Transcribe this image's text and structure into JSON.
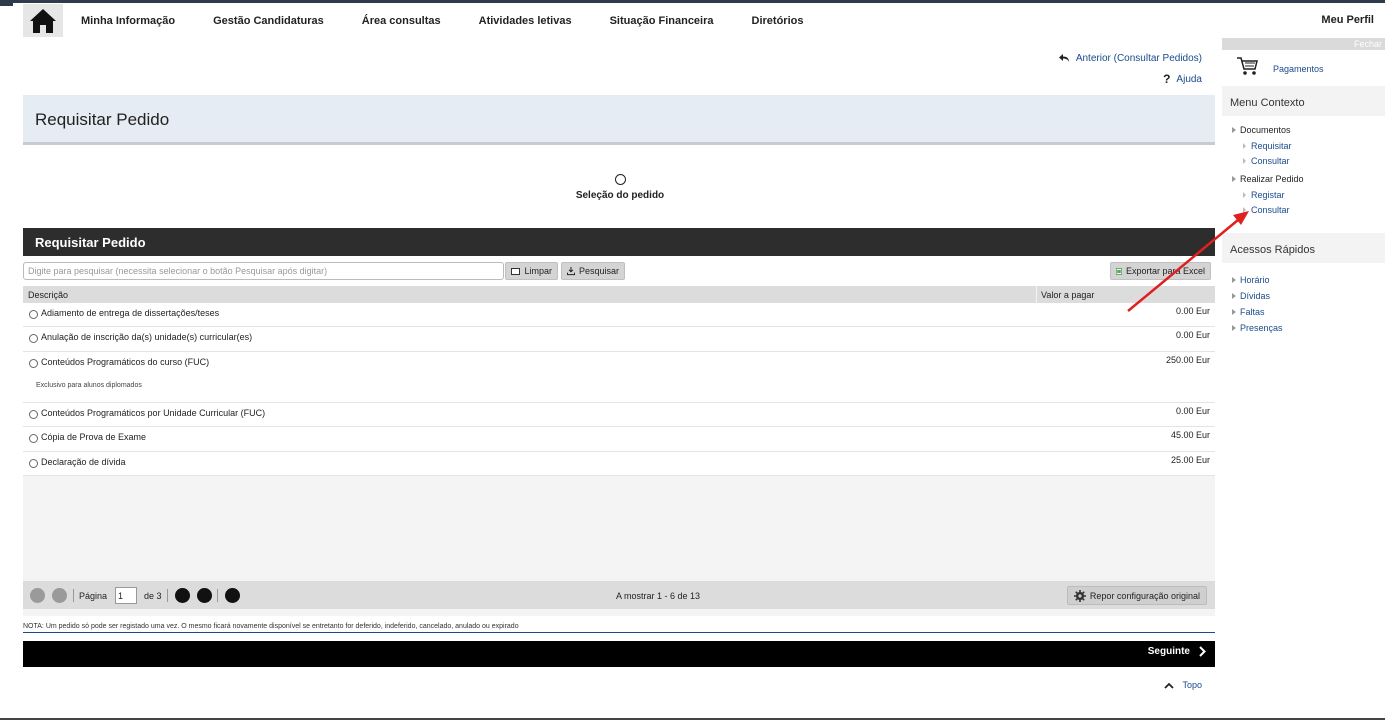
{
  "nav": {
    "items": [
      "Minha Informação",
      "Gestão Candidaturas",
      "Área consultas",
      "Atividades letivas",
      "Situação Financeira",
      "Diretórios"
    ],
    "profile": "Meu Perfil"
  },
  "links": {
    "previous": "Anterior (Consultar Pedidos)",
    "help": "Ajuda",
    "top": "Topo"
  },
  "page": {
    "title": "Requisitar Pedido",
    "step_label": "Seleção do pedido"
  },
  "panel": {
    "title": "Requisitar Pedido",
    "search_placeholder": "Digite para pesquisar (necessita selecionar o botão Pesquisar após digitar)",
    "clear_label": "Limpar",
    "search_label": "Pesquisar",
    "export_label": "Exportar para Excel",
    "col_description": "Descrição",
    "col_value": "Valor a pagar",
    "rows": [
      {
        "desc": "Adiamento de entrega de dissertações/teses",
        "value": "0.00 Eur",
        "sub": ""
      },
      {
        "desc": "Anulação de inscrição da(s) unidade(s) curricular(es)",
        "value": "0.00 Eur",
        "sub": ""
      },
      {
        "desc": "Conteúdos Programáticos do curso (FUC)",
        "value": "250.00 Eur",
        "sub": "Exclusivo para alunos diplomados"
      },
      {
        "desc": "Conteúdos Programáticos por Unidade Curricular (FUC)",
        "value": "0.00 Eur",
        "sub": ""
      },
      {
        "desc": "Cópia de Prova de Exame",
        "value": "45.00 Eur",
        "sub": ""
      },
      {
        "desc": "Declaração de dívida",
        "value": "25.00 Eur",
        "sub": ""
      }
    ]
  },
  "pager": {
    "page_label": "Página",
    "page_value": "1",
    "of_label": "de 3",
    "showing": "A mostrar 1 - 6 de 13",
    "reset_label": "Repor configuração original"
  },
  "note": "NOTA: Um pedido só pode ser registado uma vez. O mesmo ficará novamente disponível se entretanto for deferido, indeferido, cancelado, anulado ou expirado",
  "next_label": "Seguinte",
  "sidebar": {
    "close": "Fechar",
    "payments": "Pagamentos",
    "context_title": "Menu Contexto",
    "groups": [
      {
        "label": "Documentos",
        "children": [
          "Requisitar",
          "Consultar"
        ]
      },
      {
        "label": "Realizar Pedido",
        "children": [
          "Registar",
          "Consultar"
        ]
      }
    ],
    "quick_title": "Acessos Rápidos",
    "quick_links": [
      "Horário",
      "Dívidas",
      "Faltas",
      "Presenças"
    ]
  },
  "colors": {
    "link": "#1a4b8c",
    "panel_head": "#2d2d2d",
    "title_bg": "#e6ecf3",
    "annotation_arrow": "#e02020"
  }
}
